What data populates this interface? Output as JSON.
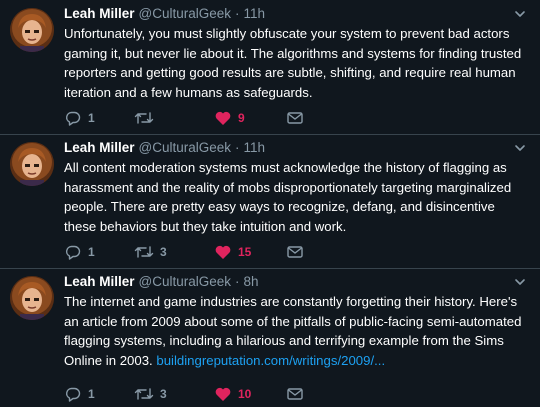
{
  "accent": {
    "link": "#1da1f2",
    "like": "#e0245e",
    "muted": "#8899a6",
    "background": "#10171e"
  },
  "tweets": [
    {
      "name": "Leah Miller",
      "handle": "@CulturalGeek",
      "separator": "·",
      "time": "11h",
      "text": "Unfortunately, you must slightly obfuscate your system to prevent bad actors gaming it, but never lie about it. The algorithms and systems for finding trusted reporters and getting good results are subtle, shifting, and require real human iteration and a few humans as safeguards.",
      "link": "",
      "replies": "1",
      "retweets": "",
      "likes": "9",
      "liked": true
    },
    {
      "name": "Leah Miller",
      "handle": "@CulturalGeek",
      "separator": "·",
      "time": "11h",
      "text": "All content moderation systems must acknowledge the history of flagging as harassment and the reality of mobs disproportionately targeting marginalized people. There are pretty easy ways to recognize, defang, and disincentive these behaviors but they take intuition and work.",
      "link": "",
      "replies": "1",
      "retweets": "3",
      "likes": "15",
      "liked": true
    },
    {
      "name": "Leah Miller",
      "handle": "@CulturalGeek",
      "separator": "·",
      "time": "8h",
      "text": "The internet and game industries are constantly forgetting their history. Here's an article from 2009 about some of the pitfalls of public-facing semi-automated flagging systems, including a hilarious and terrifying example from the Sims Online in 2003. ",
      "link": "buildingreputation.com/writings/2009/...",
      "replies": "1",
      "retweets": "3",
      "likes": "10",
      "liked": true
    }
  ],
  "icons": {
    "reply": "reply-icon",
    "retweet": "retweet-icon",
    "like": "heart-icon",
    "message": "envelope-icon",
    "menu": "chevron-down-icon"
  }
}
